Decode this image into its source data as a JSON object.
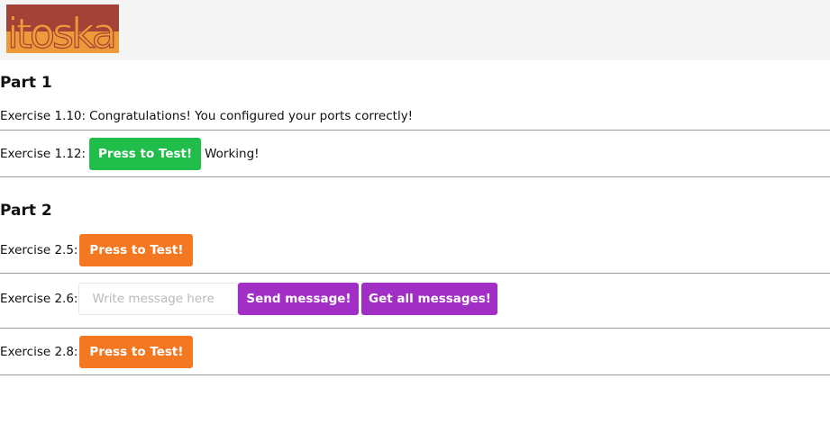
{
  "header": {
    "logo_text": "itoska",
    "colors": {
      "background": "#f4f4f4",
      "logo_dark": "#a34236",
      "logo_orange": "#ed9a3a"
    }
  },
  "part1": {
    "title": "Part 1",
    "ex110": {
      "label": "Exercise 1.10:",
      "message": "Congratulations! You configured your ports correctly!"
    },
    "ex112": {
      "label": "Exercise 1.12:",
      "button": "Press to Test!",
      "status": "Working!"
    }
  },
  "part2": {
    "title": "Part 2",
    "ex25": {
      "label": "Exercise 2.5:",
      "button": "Press to Test!"
    },
    "ex26": {
      "label": "Exercise 2.6:",
      "input_placeholder": "Write message here",
      "input_value": "",
      "send_button": "Send message!",
      "get_button": "Get all messages!"
    },
    "ex28": {
      "label": "Exercise 2.8:",
      "button": "Press to Test!"
    }
  },
  "colors": {
    "green": "#20bd4b",
    "orange": "#f47722",
    "purple": "#a12fc6",
    "divider": "#9a9a9a"
  }
}
